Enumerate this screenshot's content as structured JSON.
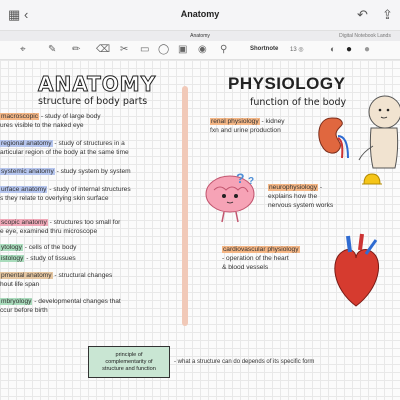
{
  "titlebar": {
    "title": "Anatomy"
  },
  "tabs": [
    {
      "label": ""
    },
    {
      "label": ""
    },
    {
      "label": "Anatomy"
    },
    {
      "label": "Digital Notebook Lands"
    }
  ],
  "toolbar": {
    "shortnote_label": "Shortnote",
    "size_value": "13 ◎"
  },
  "left": {
    "title": "ANATOMY",
    "subtitle": "structure of body parts",
    "notes": [
      {
        "term": "macroscopic",
        "rest": " - study of large body",
        "line2": "ures visible to the naked eye",
        "color": "orange"
      },
      {
        "term": "regional anatomy",
        "rest": " - study of structures in a",
        "line2": "articular region of the body at the same time",
        "color": "blue"
      },
      {
        "term": "systemic anatomy",
        "rest": " - study system by system",
        "line2": "",
        "color": "blue"
      },
      {
        "term": "urface anatomy",
        "rest": " - study of internal structures",
        "line2": "s they relate to overlying skin surface",
        "color": "blue"
      },
      {
        "term": "scopic anatomy",
        "rest": " - structures too small for",
        "line2": "e eye, examined thru microscope",
        "color": "pink"
      },
      {
        "term": "ytology",
        "rest": " - cells of the body",
        "line2": "",
        "color": "green"
      },
      {
        "term": "istology",
        "rest": " - study of tissues",
        "line2": "",
        "color": "green"
      },
      {
        "term": "pmental anatomy",
        "rest": " - structural changes",
        "line2": "hout life span",
        "color": "tan"
      },
      {
        "term": "mbryology",
        "rest": " - developmental changes that",
        "line2": "ccur before birth",
        "color": "green"
      }
    ],
    "box": {
      "line1": "principle of",
      "line2": "complementarity of",
      "line3": "structure and function"
    },
    "box_note": "- what a structure can do depends of its specific form"
  },
  "right": {
    "title": "PHYSIOLOGY",
    "subtitle": "function of the body",
    "notes": [
      {
        "term": "renal physiology",
        "rest": " - kidney",
        "line2": "fxn and urine production"
      },
      {
        "term": "neurophysiology",
        "rest": " -",
        "line2": "explains how the",
        "line3": "nervous system works"
      },
      {
        "term": "cardiovascular physiology",
        "rest": "",
        "line2": "- operation of the heart",
        "line3": "& blood vessels"
      }
    ]
  }
}
